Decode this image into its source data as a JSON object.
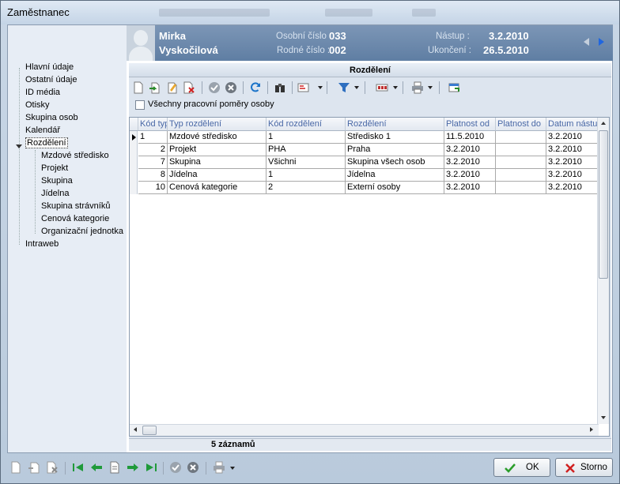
{
  "window": {
    "title": "Zaměstnanec",
    "background_ghosts": [
      "Výstupní položky",
      "Vlastnosti",
      "Zpráva"
    ]
  },
  "nav": {
    "items": [
      {
        "label": "Hlavní údaje",
        "selected": false,
        "level": 0
      },
      {
        "label": "Ostatní údaje",
        "selected": false,
        "level": 0
      },
      {
        "label": "ID média",
        "selected": false,
        "level": 0
      },
      {
        "label": "Otisky",
        "selected": false,
        "level": 0
      },
      {
        "label": "Skupina osob",
        "selected": false,
        "level": 0
      },
      {
        "label": "Kalendář",
        "selected": false,
        "level": 0
      },
      {
        "label": "Rozdělení",
        "selected": true,
        "level": 0
      },
      {
        "label": "Mzdové středisko",
        "selected": false,
        "level": 1
      },
      {
        "label": "Projekt",
        "selected": false,
        "level": 1
      },
      {
        "label": "Skupina",
        "selected": false,
        "level": 1
      },
      {
        "label": "Jídelna",
        "selected": false,
        "level": 1
      },
      {
        "label": "Skupina strávníků",
        "selected": false,
        "level": 1
      },
      {
        "label": "Cenová kategorie",
        "selected": false,
        "level": 1
      },
      {
        "label": "Organizační jednotka",
        "selected": false,
        "level": 1
      },
      {
        "label": "Intraweb",
        "selected": false,
        "level": 0
      }
    ]
  },
  "employee": {
    "first_name": "Mirka",
    "last_name": "Vyskočilová",
    "personal_number_label": "Osobní číslo :",
    "personal_number": "033",
    "birth_number_label": "Rodné číslo :",
    "birth_number": "002",
    "start_label": "Nástup :",
    "start_date": "3.2.2010",
    "end_label": "Ukončení :",
    "end_date": "26.5.2010"
  },
  "panel": {
    "title": "Rozdělení",
    "all_relations_checkbox": {
      "label": "Všechny pracovní poměry osoby",
      "checked": false
    }
  },
  "toolbar_icons": [
    "new-icon",
    "export-icon",
    "edit-icon",
    "delete-icon",
    "confirm-icon",
    "cancel-icon",
    "refresh-icon",
    "binoculars-icon",
    "sort-icon",
    "filter-icon",
    "columns-icon",
    "print-icon",
    "window-icon"
  ],
  "grid": {
    "columns": [
      "Kód typ",
      "Typ rozdělení",
      "Kód rozdělení",
      "Rozdělení",
      "Platnost od",
      "Platnost do",
      "Datum nástu"
    ],
    "rows": [
      [
        "1",
        "Mzdové středisko",
        "1",
        "Středisko 1",
        "11.5.2010",
        "",
        "3.2.2010"
      ],
      [
        "2",
        "Projekt",
        "PHA",
        "Praha",
        "3.2.2010",
        "",
        "3.2.2010"
      ],
      [
        "7",
        "Skupina",
        "Všichni",
        "Skupina všech osob",
        "3.2.2010",
        "",
        "3.2.2010"
      ],
      [
        "8",
        "Jídelna",
        "1",
        "Jídelna",
        "3.2.2010",
        "",
        "3.2.2010"
      ],
      [
        "10",
        "Cenová kategorie",
        "2",
        "Externí osoby",
        "3.2.2010",
        "",
        "3.2.2010"
      ]
    ],
    "current_row": 0
  },
  "status": {
    "record_count": "5 záznamů"
  },
  "buttons": {
    "ok": "OK",
    "cancel": "Storno"
  },
  "colors": {
    "header_bg": "#6784a8",
    "accent_blue": "#4968a6",
    "ok_check": "#2a9d2a",
    "cancel_x": "#d02020"
  }
}
